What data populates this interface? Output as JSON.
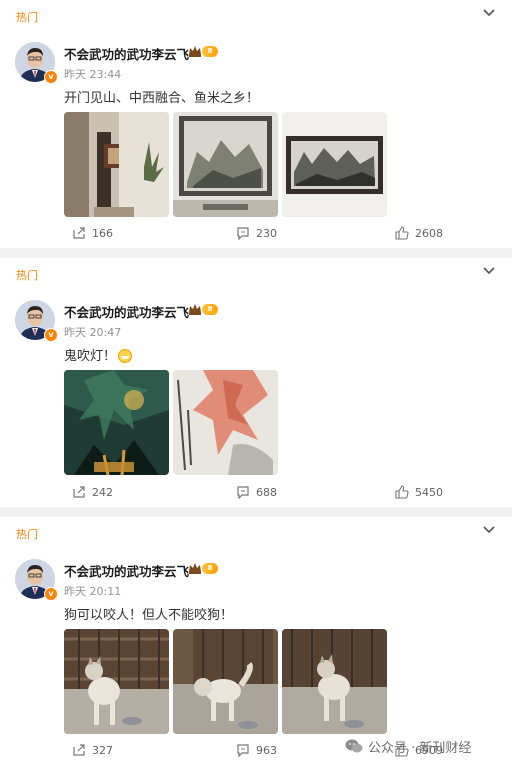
{
  "feed": {
    "posts": [
      {
        "tag": "热门",
        "author": "不会武功的武功李云飞",
        "vip_text": "8",
        "time": "昨天 23:44",
        "text": "开门见山、中西融合、鱼米之乡！",
        "images": [
          "hallway-photo",
          "framed-landscape-painting",
          "framed-ink-landscape"
        ],
        "reposts": "166",
        "comments": "230",
        "likes": "2608"
      },
      {
        "tag": "热门",
        "author": "不会武功的武功李云飞",
        "vip_text": "8",
        "time": "昨天 20:47",
        "text": "鬼吹灯！",
        "images": [
          "movie-poster",
          "red-figure-painting"
        ],
        "reposts": "242",
        "comments": "688",
        "likes": "5450"
      },
      {
        "tag": "热门",
        "author": "不会武功的武功李云飞",
        "vip_text": "8",
        "time": "昨天 20:11",
        "text": "狗可以咬人！但人不能咬狗！",
        "images": [
          "dog-photo-1",
          "dog-photo-2",
          "dog-photo-3"
        ],
        "reposts": "327",
        "comments": "963",
        "likes": "6909"
      }
    ]
  },
  "watermark": {
    "text": "公众号 · 新刊财经"
  }
}
